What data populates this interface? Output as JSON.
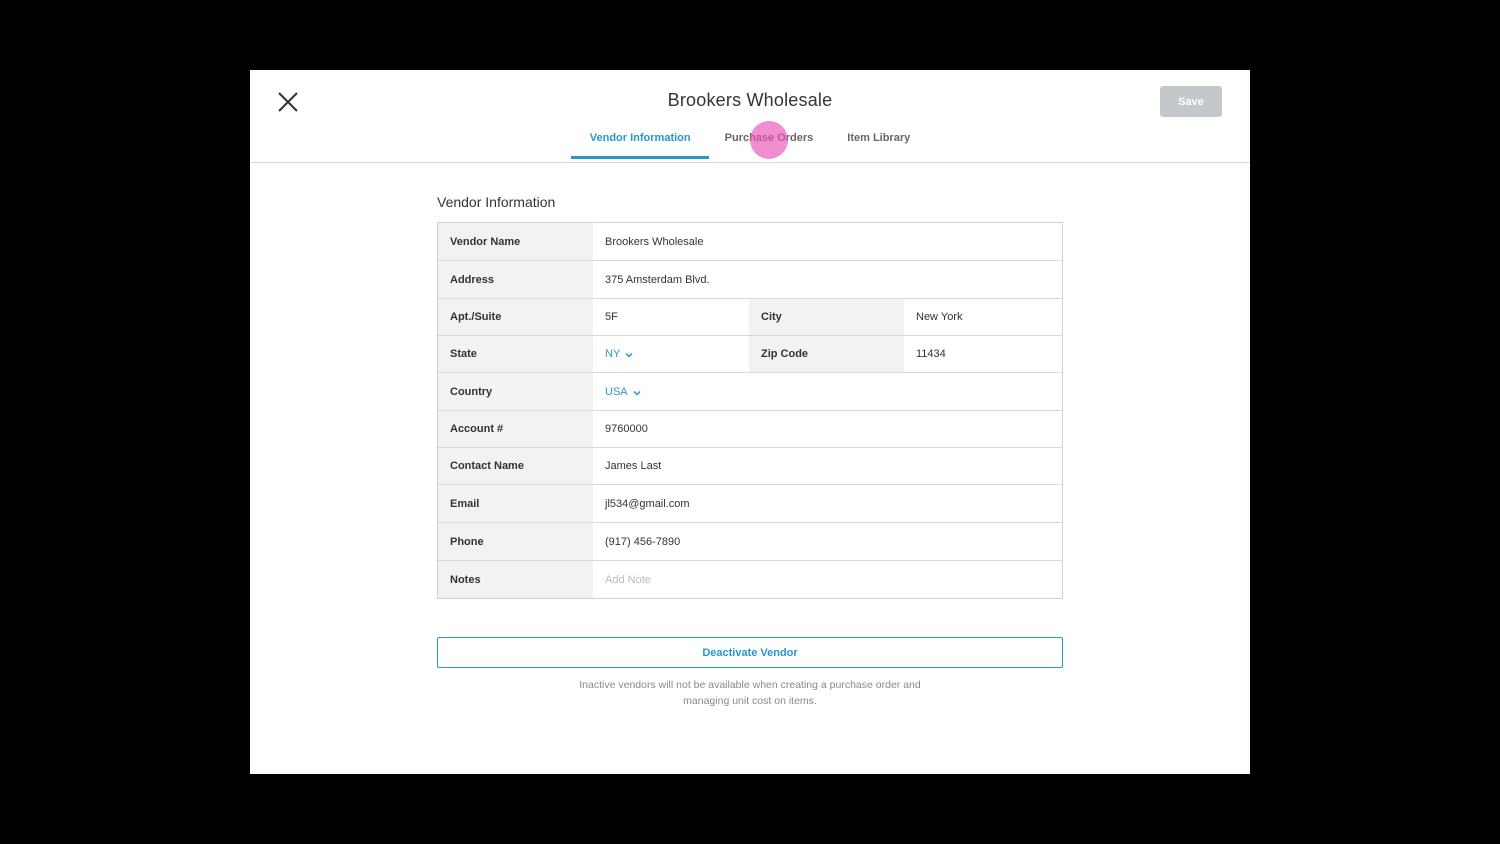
{
  "header": {
    "title": "Brookers Wholesale",
    "save_label": "Save",
    "close_icon": "close-icon"
  },
  "tabs": [
    {
      "label": "Vendor Information",
      "active": true
    },
    {
      "label": "Purchase Orders",
      "active": false
    },
    {
      "label": "Item Library",
      "active": false
    }
  ],
  "section_title": "Vendor Information",
  "fields": {
    "vendor_name": {
      "label": "Vendor Name",
      "value": "Brookers Wholesale"
    },
    "address": {
      "label": "Address",
      "value": "375 Amsterdam Blvd."
    },
    "apt": {
      "label": "Apt./Suite",
      "value": "5F"
    },
    "city": {
      "label": "City",
      "value": "New York"
    },
    "state": {
      "label": "State",
      "value": "NY"
    },
    "zip": {
      "label": "Zip Code",
      "value": "11434"
    },
    "country": {
      "label": "Country",
      "value": "USA"
    },
    "account": {
      "label": "Account #",
      "value": "9760000"
    },
    "contact": {
      "label": "Contact Name",
      "value": "James Last"
    },
    "email": {
      "label": "Email",
      "value": "jl534@gmail.com"
    },
    "phone": {
      "label": "Phone",
      "value": "(917) 456-7890"
    },
    "notes": {
      "label": "Notes",
      "placeholder": "Add Note"
    }
  },
  "deactivate_label": "Deactivate Vendor",
  "help_text": {
    "line1": "Inactive vendors will not be available when creating a purchase order and",
    "line2": "managing unit cost on items."
  },
  "colors": {
    "accent": "#2996cc",
    "save_disabled": "#c5c8cb",
    "tap_indicator": "#e852b6"
  }
}
